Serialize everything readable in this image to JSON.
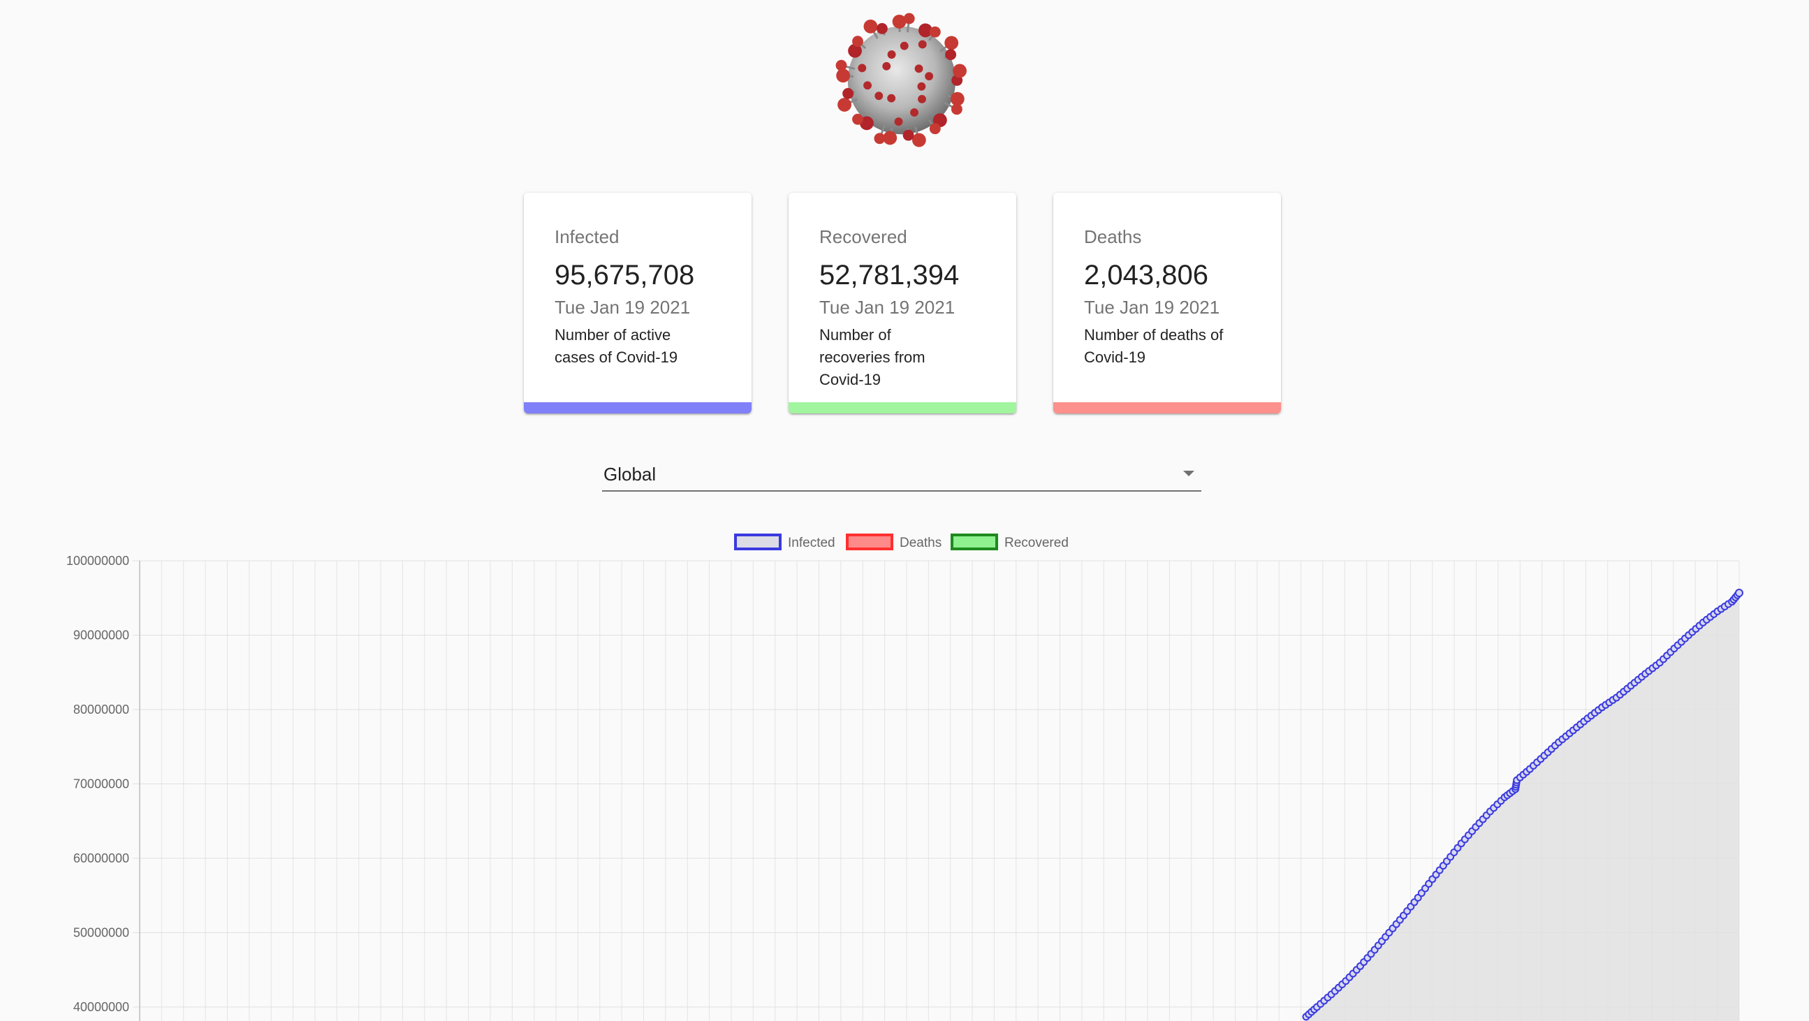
{
  "colors": {
    "infected": "#8080f8",
    "recovered": "#a0f59e",
    "deaths": "#fc908d",
    "infected_line": "#3a3adf",
    "chart_fill": "#e0e0e0"
  },
  "cards": [
    {
      "key": "infected",
      "label": "Infected",
      "value": "95,675,708",
      "date": "Tue Jan 19 2021",
      "description": "Number of active cases of Covid-19"
    },
    {
      "key": "recovered",
      "label": "Recovered",
      "value": "52,781,394",
      "date": "Tue Jan 19 2021",
      "description": "Number of recoveries from Covid-19"
    },
    {
      "key": "deaths",
      "label": "Deaths",
      "value": "2,043,806",
      "date": "Tue Jan 19 2021",
      "description": "Number of deaths of Covid-19"
    }
  ],
  "country_select": {
    "value": "Global"
  },
  "chart_data": {
    "type": "line",
    "legend": [
      {
        "name": "Infected",
        "border": "#3a3adf",
        "fill": "#dcdce6"
      },
      {
        "name": "Deaths",
        "border": "#ff3030",
        "fill": "#ff8a8a"
      },
      {
        "name": "Recovered",
        "border": "#1e8a1e",
        "fill": "#8ef08e"
      }
    ],
    "legend_position": "top",
    "grid": true,
    "y_ticks": [
      "100000000",
      "90000000",
      "80000000",
      "70000000",
      "60000000",
      "50000000",
      "40000000"
    ],
    "ylim_visible": [
      38000000,
      100000000
    ],
    "series": [
      {
        "name": "Infected",
        "points_visible_tail": [
          [
            0.0,
            38700000
          ],
          [
            0.015,
            40000000
          ],
          [
            0.035,
            41700000
          ],
          [
            0.055,
            43500000
          ],
          [
            0.075,
            45500000
          ],
          [
            0.095,
            47700000
          ],
          [
            0.115,
            50000000
          ],
          [
            0.135,
            52300000
          ],
          [
            0.155,
            54700000
          ],
          [
            0.175,
            57200000
          ],
          [
            0.195,
            59600000
          ],
          [
            0.215,
            62000000
          ],
          [
            0.235,
            64200000
          ],
          [
            0.255,
            66300000
          ],
          [
            0.275,
            68200000
          ],
          [
            0.29,
            69300000
          ],
          [
            0.292,
            70500000
          ],
          [
            0.31,
            72000000
          ],
          [
            0.33,
            73800000
          ],
          [
            0.35,
            75600000
          ],
          [
            0.37,
            77200000
          ],
          [
            0.39,
            78800000
          ],
          [
            0.41,
            80300000
          ],
          [
            0.43,
            81600000
          ],
          [
            0.45,
            83200000
          ],
          [
            0.47,
            84800000
          ],
          [
            0.49,
            86300000
          ],
          [
            0.51,
            88200000
          ],
          [
            0.53,
            90000000
          ],
          [
            0.55,
            91700000
          ],
          [
            0.57,
            93200000
          ],
          [
            0.59,
            94500000
          ],
          [
            0.6,
            95675708
          ]
        ]
      }
    ]
  }
}
